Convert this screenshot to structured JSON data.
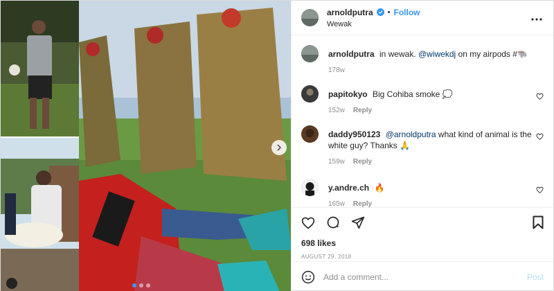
{
  "header": {
    "username": "arnoldputra",
    "separator": "•",
    "follow_label": "Follow",
    "location": "Wewak",
    "more_icon": "more-horizontal-icon"
  },
  "caption": {
    "username": "arnoldputra",
    "text_before": "in wewak.",
    "mention": "@wiwekdj",
    "text_after": "on my airpods #🐃",
    "time": "178w"
  },
  "comments": [
    {
      "username": "papitokyo",
      "mention": "",
      "text": "Big Cohiba smoke 💭",
      "time": "152w",
      "reply_label": "Reply"
    },
    {
      "username": "daddy950123",
      "mention": "@arnoldputra",
      "text": "what kind of animal is the white guy? Thanks 🙏",
      "time": "159w",
      "reply_label": "Reply"
    },
    {
      "username": "y.andre.ch",
      "mention": "",
      "text": "🔥",
      "time": "165w",
      "reply_label": "Reply"
    }
  ],
  "actions": {
    "likes": "698 likes",
    "date": "August 29, 2018"
  },
  "add_comment": {
    "placeholder": "Add a comment...",
    "post_label": "Post"
  },
  "colors": {
    "accent": "#3897f0",
    "post_disabled": "#b2dffc",
    "muted": "#8e8e8e",
    "text": "#262626"
  },
  "carousel": {
    "slides": 3,
    "active": 0
  }
}
